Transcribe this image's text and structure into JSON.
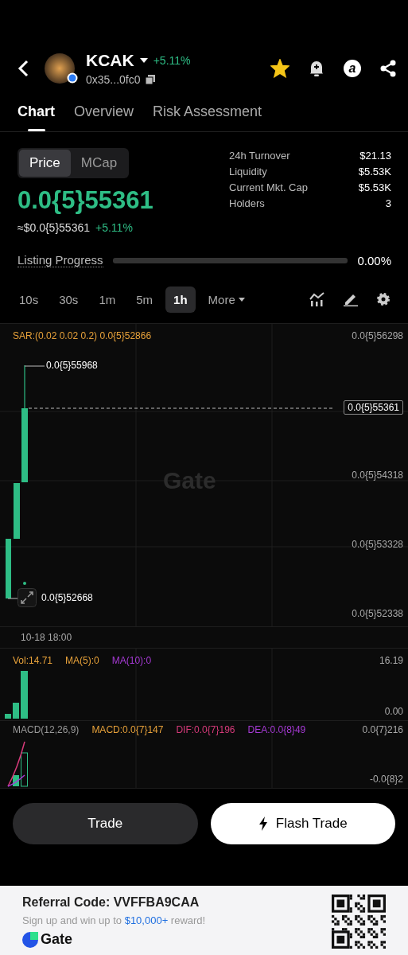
{
  "header": {
    "title": "KCAK",
    "change": "+5.11%",
    "address": "0x35...0fc0",
    "favorited": true,
    "account_letter": "a"
  },
  "tabs": [
    {
      "label": "Chart",
      "selected": true
    },
    {
      "label": "Overview",
      "selected": false
    },
    {
      "label": "Risk Assessment",
      "selected": false
    }
  ],
  "mode_toggle": [
    {
      "label": "Price",
      "selected": true
    },
    {
      "label": "MCap",
      "selected": false
    }
  ],
  "price": {
    "value": "0.0{5}55361",
    "usd": "≈$0.0{5}55361",
    "change": "+5.11%"
  },
  "stats": [
    {
      "label": "24h Turnover",
      "value": "$21.13"
    },
    {
      "label": "Liquidity",
      "value": "$5.53K"
    },
    {
      "label": "Current Mkt. Cap",
      "value": "$5.53K"
    },
    {
      "label": "Holders",
      "value": "3"
    }
  ],
  "listing": {
    "label": "Listing Progress",
    "level": 0,
    "reading": "0.00%"
  },
  "intervals": [
    {
      "label": "10s",
      "selected": false
    },
    {
      "label": "30s",
      "selected": false
    },
    {
      "label": "1m",
      "selected": false
    },
    {
      "label": "5m",
      "selected": false
    },
    {
      "label": "1h",
      "selected": true
    }
  ],
  "more": "More",
  "chart": {
    "indicator": "SAR:(0.02 0.02 0.2) 0.0{5}52866",
    "price_labels": [
      "0.0{5}56298",
      "0.0{5}54318",
      "0.0{5}53328",
      "0.0{5}52338"
    ],
    "current": "0.0{5}55361",
    "high": "0.0{5}55968",
    "low": "0.0{5}52668",
    "time": "10-18 18:00",
    "watermark": "Gate"
  },
  "volume": {
    "labels": [
      {
        "text": "Vol:14.71",
        "color": "#e8a23a"
      },
      {
        "text": "MA(5):0",
        "color": "#e8a23a"
      },
      {
        "text": "MA(10):0",
        "color": "#a73ad6"
      }
    ],
    "max": "16.19",
    "min": "0.00"
  },
  "macd": {
    "labels": [
      {
        "text": "MACD(12,26,9)",
        "color": "#9a9a9a"
      },
      {
        "text": "MACD:0.0{7}147",
        "color": "#e8a23a"
      },
      {
        "text": "DIF:0.0{7}196",
        "color": "#d63a7a"
      },
      {
        "text": "DEA:0.0{8}49",
        "color": "#a73ad6"
      }
    ],
    "max": "0.0{7}216",
    "min": "-0.0{8}2"
  },
  "buttons": [
    {
      "label": "Trade",
      "kind": "secondary"
    },
    {
      "label": "Flash Trade",
      "kind": "primary"
    }
  ],
  "footer": {
    "referral": "Referral Code: VVFFBA9CAA",
    "promo_before": "Sign up and win up to",
    "promo_amount": "$10,000+",
    "promo_after": "reward!",
    "brand": "Gate"
  }
}
